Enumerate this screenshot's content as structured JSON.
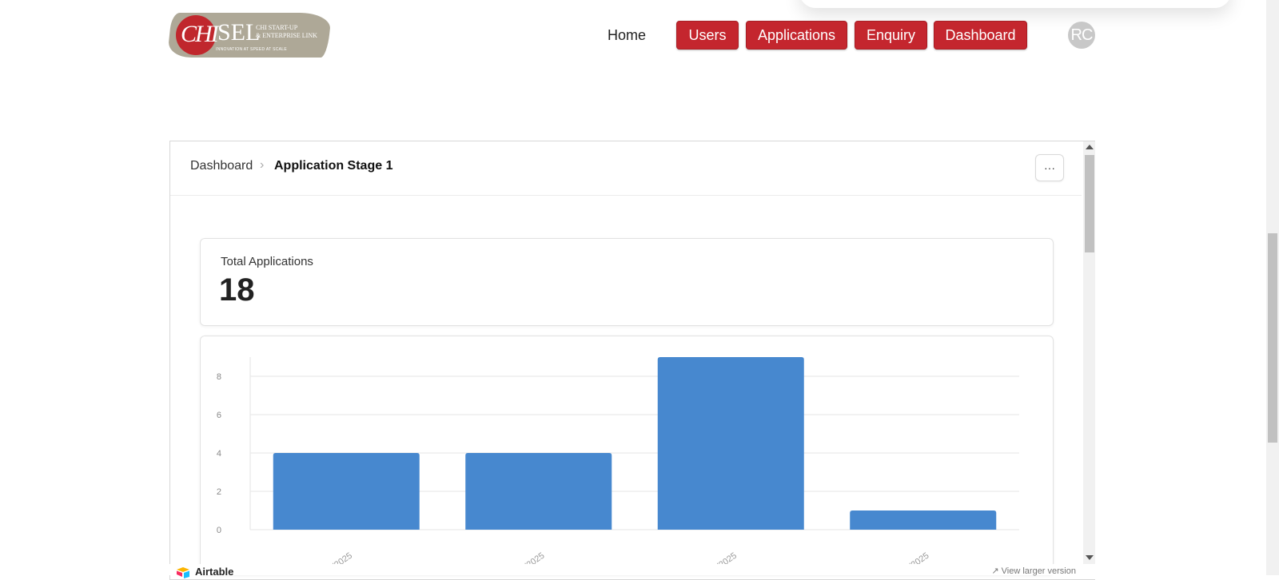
{
  "logo": {
    "monogram": "CHI",
    "word": "SEL",
    "tagline_1": "CHI START-UP",
    "tagline_2": "& ENTERPRISE LINK",
    "tagline_3": "INNOVATION AT SPEED AT SCALE"
  },
  "nav": {
    "home": "Home",
    "buttons": [
      "Users",
      "Applications",
      "Enquiry",
      "Dashboard"
    ],
    "avatar": "RC"
  },
  "dashboard": {
    "breadcrumb_root": "Dashboard",
    "breadcrumb_separator": "›",
    "breadcrumb_current": "Application Stage 1",
    "more_button": "···",
    "total_label": "Total Applications",
    "total_value": "18"
  },
  "footer": {
    "brand": "Airtable",
    "larger_link": "↗ View larger version"
  },
  "colors": {
    "brand_red": "#c4262e",
    "bar_blue": "#4788cf"
  },
  "chart_data": {
    "type": "bar",
    "categories": [
      "/2025",
      "/2025",
      "/2025",
      "/2025"
    ],
    "values": [
      4,
      4,
      9,
      1
    ],
    "yticks": [
      0,
      2,
      4,
      6,
      8
    ],
    "ylim": [
      0,
      9
    ],
    "grid": true,
    "title": "",
    "xlabel": "",
    "ylabel": ""
  }
}
